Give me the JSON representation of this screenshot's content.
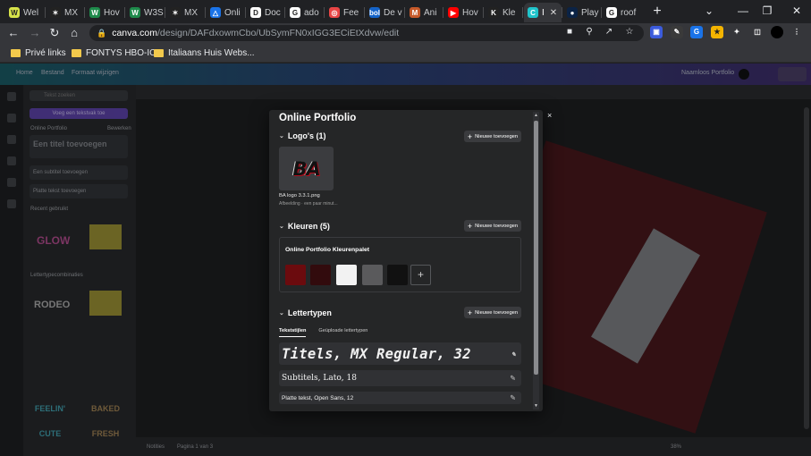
{
  "browser": {
    "tabs": [
      {
        "label": "Wel",
        "fav": "W",
        "color": "#d7e34a"
      },
      {
        "label": "MX",
        "fav": "✶",
        "color": "#222"
      },
      {
        "label": "Hov",
        "fav": "W",
        "color": "#1e8a4b"
      },
      {
        "label": "W3S",
        "fav": "W",
        "color": "#1e8a4b"
      },
      {
        "label": "MX",
        "fav": "✶",
        "color": "#222"
      },
      {
        "label": "Onli",
        "fav": "△",
        "color": "#1a73e8"
      },
      {
        "label": "Doc",
        "fav": "D",
        "color": "#ffffff"
      },
      {
        "label": "ado",
        "fav": "G",
        "color": "#ffffff"
      },
      {
        "label": "Fee",
        "fav": "◎",
        "color": "#e94545"
      },
      {
        "label": "De v",
        "fav": "bol",
        "color": "#1463c8"
      },
      {
        "label": "Ani",
        "fav": "M",
        "color": "#c75a2a"
      },
      {
        "label": "Hov",
        "fav": "▶",
        "color": "#ff0000"
      },
      {
        "label": "Kle",
        "fav": "K",
        "color": "#222"
      },
      {
        "label": "I",
        "fav": "C",
        "color": "#20c4cb"
      },
      {
        "label": "Play",
        "fav": "●",
        "color": "#0b2345"
      },
      {
        "label": "roof",
        "fav": "G",
        "color": "#ffffff"
      }
    ],
    "new_tab_icon": "+",
    "window_controls": [
      "⌄",
      "—",
      "❐",
      "✕"
    ],
    "url_host": "canva.com",
    "url_path": "/design/DAFdxowmCbo/UbSymFN0xIGG3ECiEtXdvw/edit",
    "bookmarks": [
      "Privé links",
      "FONTYS HBO-ICT",
      "Italiaans Huis Webs..."
    ]
  },
  "canva": {
    "topbar_left": [
      "Home",
      "Bestand",
      "Formaat wijzigen"
    ],
    "topbar_right": "Naamloos Portfolio",
    "side": {
      "search": "Tekst zoeken",
      "brand_button": "Voeg een tekstvak toe",
      "kit_label": "Online Portfolio",
      "kit_link": "Bewerken",
      "rows": [
        "Een titel toevoegen",
        "Een subtitel toevoegen",
        "Platte tekst toevoegen"
      ],
      "section1": "Recent gebruikt",
      "section2": "Lettertypecombinaties"
    },
    "status_left": "Notities",
    "status_page": "Pagina 1 van 3",
    "zoom": "38%"
  },
  "dialog": {
    "title": "Online Portfolio",
    "close": "×",
    "logos": {
      "heading": "Logo's (1)",
      "add": "Nieuwe toevoegen",
      "logo_text": "BA",
      "file_name": "BA logo 3.3.1.png",
      "file_desc": "Afbeelding · een paar minut..."
    },
    "colors": {
      "heading": "Kleuren (5)",
      "add": "Nieuwe toevoegen",
      "palette_name": "Online Portfolio Kleurenpalet",
      "swatches": [
        "#6b0b0e",
        "#320b0d",
        "#f2f2f2",
        "#5a5a5c",
        "#111111"
      ],
      "add_swatch": "+"
    },
    "fonts": {
      "heading": "Lettertypen",
      "add": "Nieuwe toevoegen",
      "tabs": [
        "Tekststijlen",
        "Geüploade lettertypen"
      ],
      "title_style": "Titels, MX Regular, 32",
      "subtitle_style": "Subtitels, Lato, 18",
      "body_style": "Platte tekst, Open Sans, 12"
    }
  }
}
